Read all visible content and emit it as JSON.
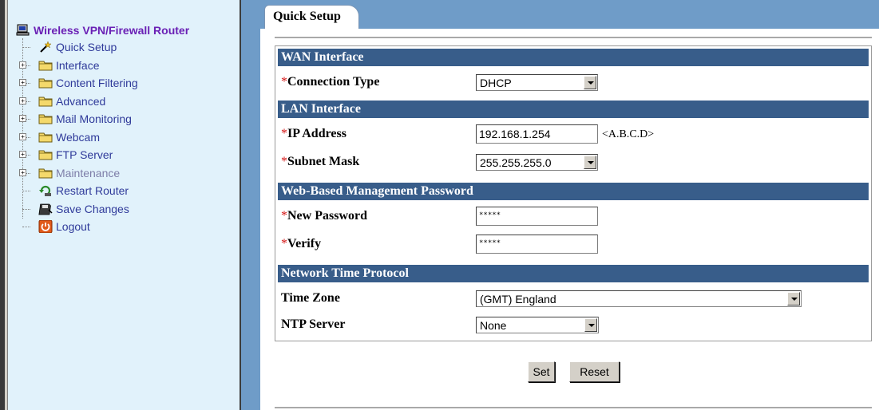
{
  "sidebar": {
    "root": {
      "label": "Wireless VPN/Firewall Router",
      "icon": "computer-icon"
    },
    "items": [
      {
        "label": "Quick Setup",
        "icon": "wand-icon",
        "expandable": false,
        "dim": false
      },
      {
        "label": "Interface",
        "icon": "folder-icon",
        "expandable": true,
        "dim": false
      },
      {
        "label": "Content Filtering",
        "icon": "folder-icon",
        "expandable": true,
        "dim": false
      },
      {
        "label": "Advanced",
        "icon": "folder-icon",
        "expandable": true,
        "dim": false
      },
      {
        "label": "Mail Monitoring",
        "icon": "folder-icon",
        "expandable": true,
        "dim": false
      },
      {
        "label": "Webcam",
        "icon": "folder-icon",
        "expandable": true,
        "dim": false
      },
      {
        "label": "FTP Server",
        "icon": "folder-icon",
        "expandable": true,
        "dim": false
      },
      {
        "label": "Maintenance",
        "icon": "folder-icon",
        "expandable": true,
        "dim": true
      },
      {
        "label": "Restart Router",
        "icon": "restart-icon",
        "expandable": false,
        "dim": false
      },
      {
        "label": "Save Changes",
        "icon": "save-icon",
        "expandable": false,
        "dim": false
      },
      {
        "label": "Logout",
        "icon": "power-icon",
        "expandable": false,
        "dim": false
      }
    ]
  },
  "tab": {
    "label": "Quick Setup"
  },
  "sections": {
    "wan": "WAN Interface",
    "lan": "LAN Interface",
    "password": "Web-Based Management Password",
    "ntp": "Network Time Protocol"
  },
  "required_mark": "*",
  "fields": {
    "connection_type": {
      "label": "Connection Type",
      "value": "DHCP"
    },
    "ip_address": {
      "label": "IP Address",
      "value": "192.168.1.254",
      "hint": "<A.B.C.D>"
    },
    "subnet_mask": {
      "label": "Subnet Mask",
      "value": "255.255.255.0"
    },
    "new_password": {
      "label": "New Password",
      "value": "*****"
    },
    "verify": {
      "label": "Verify",
      "value": "*****"
    },
    "time_zone": {
      "label": "Time Zone",
      "value": "(GMT) England"
    },
    "ntp_server": {
      "label": "NTP Server",
      "value": "None"
    }
  },
  "buttons": {
    "set": "Set",
    "reset": "Reset"
  },
  "colors": {
    "sidebar_bg": "#e1f2fb",
    "tabbar_bg": "#6f9cc8",
    "section_header_bg": "#385d8a",
    "root_label": "#6a20b5",
    "tree_label": "#2f3a9a",
    "required": "#d41414"
  }
}
